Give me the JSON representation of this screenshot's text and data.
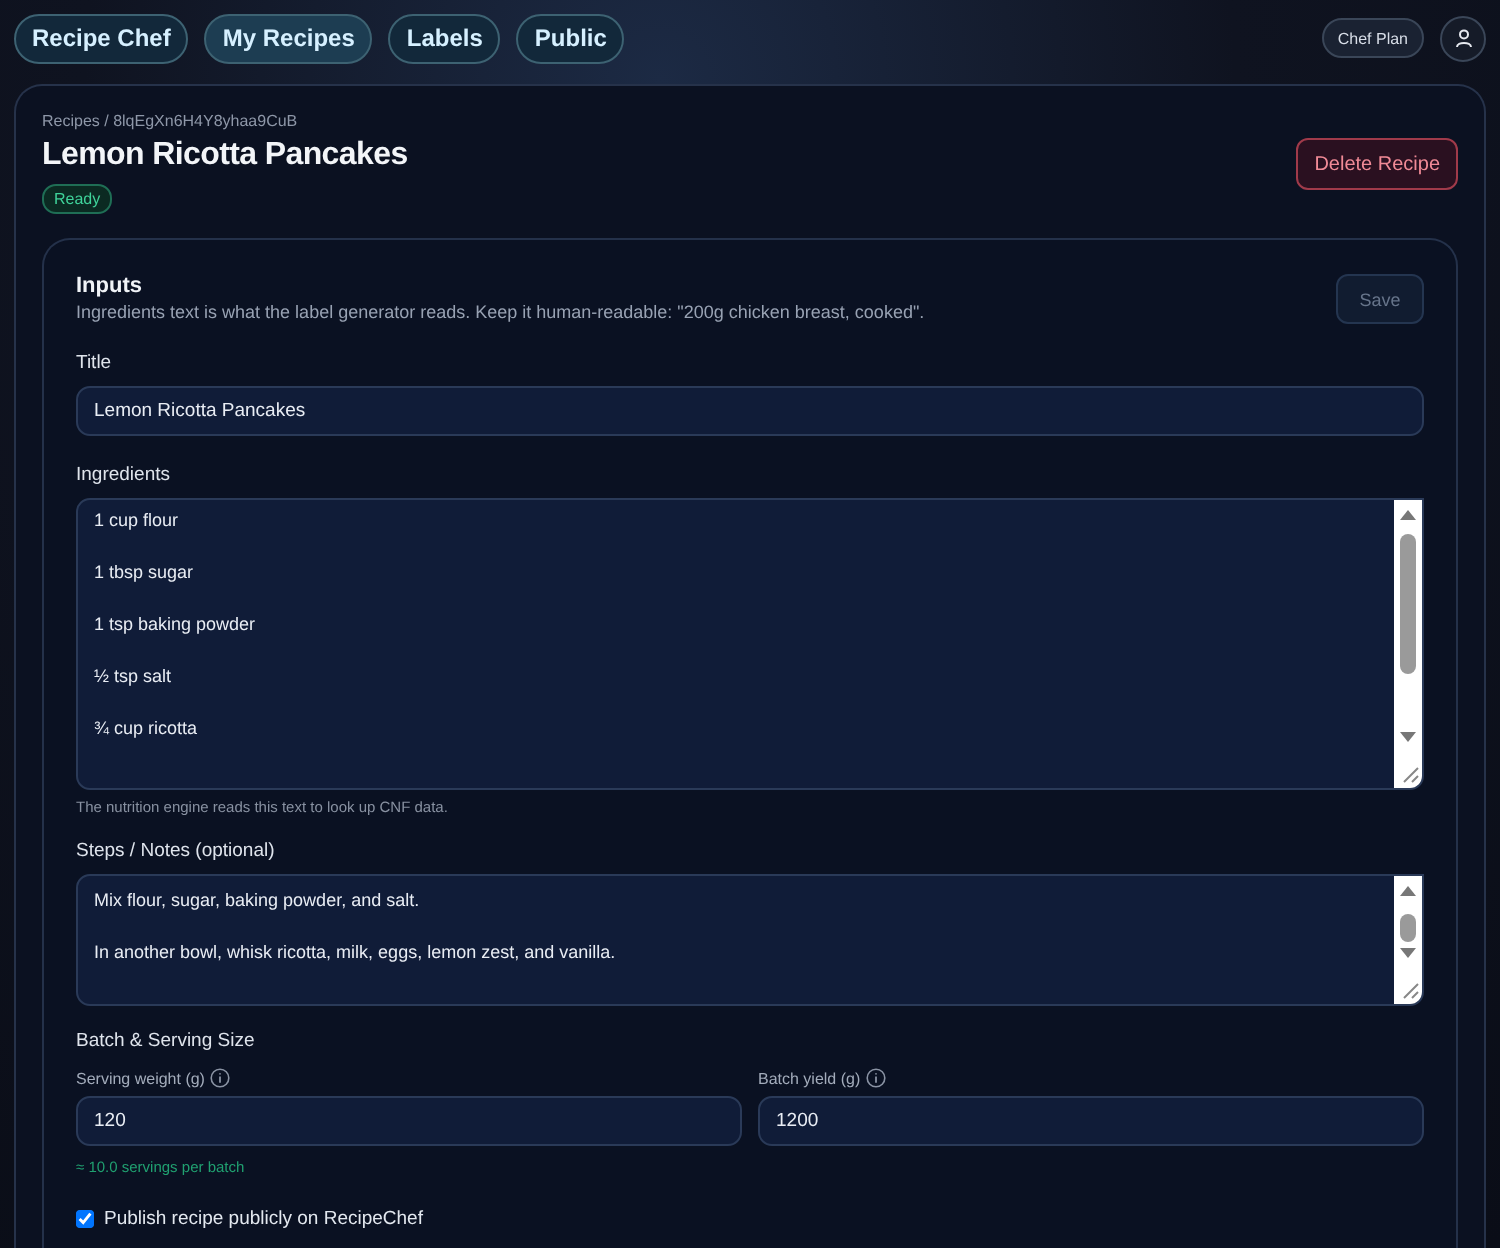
{
  "nav": [
    {
      "label": "Recipe Chef",
      "selected": false
    },
    {
      "label": "My Recipes",
      "selected": true
    },
    {
      "label": "Labels",
      "selected": false
    },
    {
      "label": "Public",
      "selected": false
    }
  ],
  "plan": "Chef Plan",
  "breadcrumb": "Recipes / 8lqEgXn6H4Y8yhaa9CuB",
  "title": "Lemon Ricotta Pancakes",
  "status": "Ready",
  "delete_button": "Delete Recipe",
  "inputs": {
    "heading": "Inputs",
    "description": "Ingredients text is what the label generator reads. Keep it human-readable: \"200g chicken breast, cooked\".",
    "save_button": "Save",
    "save_disabled": true,
    "title_label": "Title",
    "title_value": "Lemon Ricotta Pancakes",
    "ingredients_label": "Ingredients",
    "ingredients": [
      "1 cup flour",
      "1 tbsp sugar",
      "1 tsp baking powder",
      "½ tsp salt",
      "¾ cup ricotta"
    ],
    "ingredients_hint": "The nutrition engine reads this text to look up CNF data.",
    "steps_label": "Steps / Notes (optional)",
    "steps": [
      "Mix flour, sugar, baking powder, and salt.",
      "In another bowl, whisk ricotta, milk, eggs, lemon zest, and vanilla."
    ],
    "batch_heading": "Batch & Serving Size",
    "serving_label": "Serving weight (g)",
    "serving_value": "120",
    "yield_label": "Batch yield (g)",
    "yield_value": "1200",
    "servings_note": "≈ 10.0 servings per batch",
    "publish_label": "Publish recipe publicly on RecipeChef",
    "publish_checked": true
  }
}
